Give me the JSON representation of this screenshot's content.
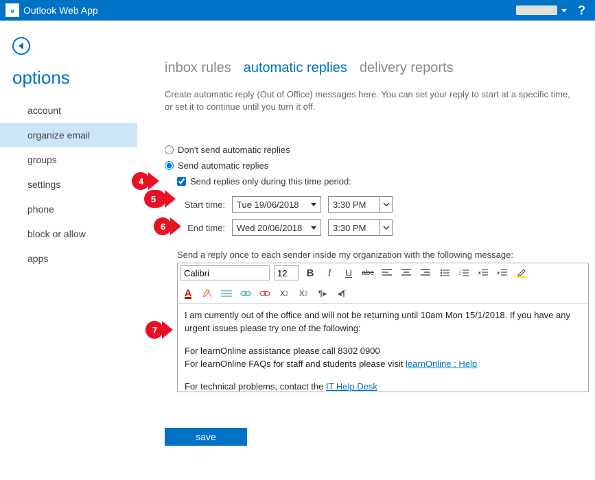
{
  "app": {
    "title": "Outlook Web App",
    "logo_text": "O↑"
  },
  "header": {
    "help_label": "?"
  },
  "sidebar": {
    "title": "options",
    "items": [
      {
        "label": "account"
      },
      {
        "label": "organize email"
      },
      {
        "label": "groups"
      },
      {
        "label": "settings"
      },
      {
        "label": "phone"
      },
      {
        "label": "block or allow"
      },
      {
        "label": "apps"
      }
    ],
    "active_index": 1
  },
  "tabs": {
    "items": [
      {
        "label": "inbox rules"
      },
      {
        "label": "automatic replies"
      },
      {
        "label": "delivery reports"
      }
    ],
    "active_index": 1
  },
  "page": {
    "description": "Create automatic reply (Out of Office) messages here. You can set your reply to start at a specific time, or set it to continue until you turn it off.",
    "radio_off_label": "Don't send automatic replies",
    "radio_on_label": "Send automatic replies",
    "radio_selected": "on",
    "timeperiod_checked": true,
    "timeperiod_label": "Send replies only during this time period:",
    "start_label": "Start time:",
    "start_date": "Tue 19/06/2018",
    "start_time": "3:30 PM",
    "end_label": "End time:",
    "end_date": "Wed 20/06/2018",
    "end_time": "3:30 PM",
    "internal_label": "Send a reply once to each sender inside my organization with the following message:",
    "save_label": "save"
  },
  "editor": {
    "font_name": "Calibri",
    "font_size": "12",
    "body_line1": "I am currently out of the office and will not be returning until 10am Mon 15/1/2018. If you have any urgent issues please try one of the following:",
    "body_line2_a": "For learnOnline assistance please call 8302 0900",
    "body_line2_b_pre": "For learnOnline FAQs for staff and students please visit ",
    "body_line2_b_link": "learnOnline : Help",
    "body_line3_pre": "For technical problems, contact the ",
    "body_line3_link": "IT Help Desk"
  },
  "annotations": {
    "c4": "4",
    "c5": "5",
    "c6": "6",
    "c7": "7"
  }
}
